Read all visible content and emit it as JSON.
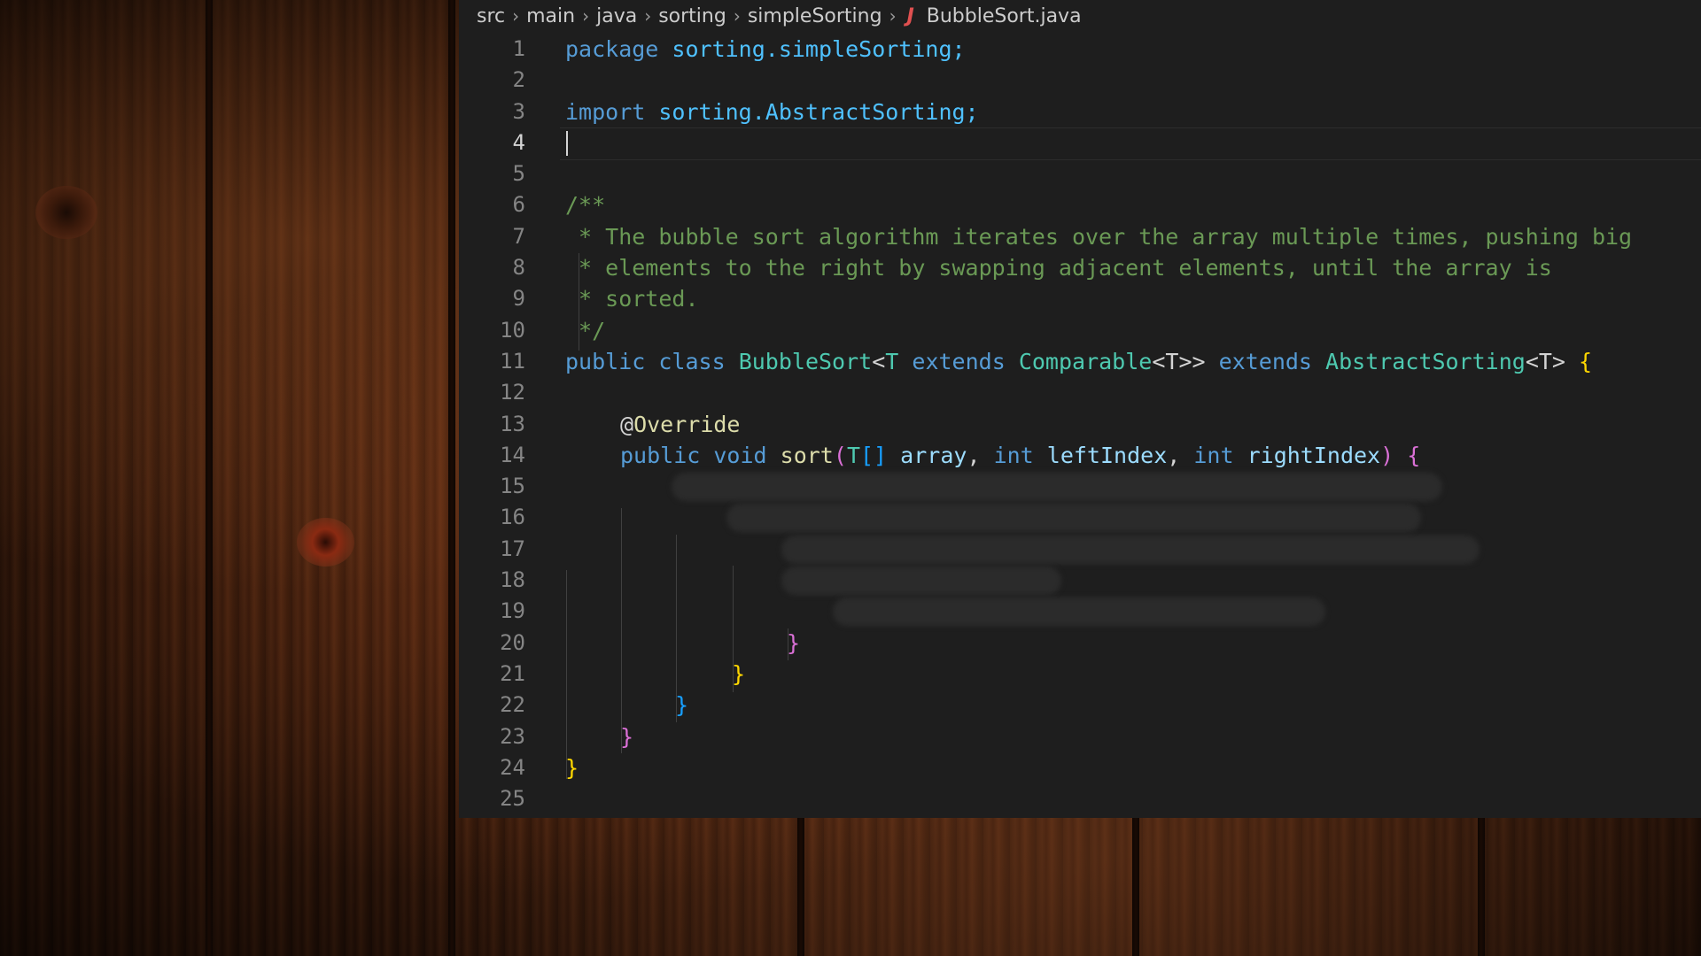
{
  "breadcrumb": {
    "items": [
      "src",
      "main",
      "java",
      "sorting",
      "simpleSorting"
    ],
    "file_icon": "java-icon",
    "file_name": "BubbleSort.java"
  },
  "editor": {
    "active_line": 4,
    "line_numbers": [
      "1",
      "2",
      "3",
      "4",
      "5",
      "6",
      "7",
      "8",
      "9",
      "10",
      "11",
      "12",
      "13",
      "14",
      "15",
      "16",
      "17",
      "18",
      "19",
      "20",
      "21",
      "22",
      "23",
      "24",
      "25"
    ],
    "code": {
      "l1_kw": "package",
      "l1_pkg": "sorting.simpleSorting;",
      "l3_kw": "import",
      "l3_pkg": "sorting.AbstractSorting;",
      "l6": "/**",
      "l7": " * The bubble sort algorithm iterates over the array multiple times, pushing big",
      "l8": " * elements to the right by swapping adjacent elements, until the array is",
      "l9": " * sorted.",
      "l10": " */",
      "l11_public": "public",
      "l11_class": "class",
      "l11_name": "BubbleSort",
      "l11_lt": "<",
      "l11_T": "T",
      "l11_extends1": "extends",
      "l11_comparable": "Comparable",
      "l11_gen1": "<T>>",
      "l11_extends2": "extends",
      "l11_abstract": "AbstractSorting",
      "l11_gen2": "<T>",
      "l11_brace": "{",
      "l13_at": "@",
      "l13_override": "Override",
      "l14_public": "public",
      "l14_void": "void",
      "l14_sort": "sort",
      "l14_paren_open": "(",
      "l14_T": "T",
      "l14_arr": "[]",
      "l14_array": "array",
      "l14_comma1": ",",
      "l14_int1": "int",
      "l14_left": "leftIndex",
      "l14_comma2": ",",
      "l14_int2": "int",
      "l14_right": "rightIndex",
      "l14_paren_close": ")",
      "l14_brace": "{",
      "l20": "}",
      "l21": "}",
      "l22": "}",
      "l23": "}",
      "l24": "}"
    }
  },
  "colors": {
    "editor_bg": "#1e1e1e",
    "keyword": "#569cd6",
    "type": "#4ec9b0",
    "comment": "#6a9955",
    "bracket_gold": "#ffd700",
    "bracket_purple": "#da70d6",
    "bracket_blue": "#179fff"
  }
}
